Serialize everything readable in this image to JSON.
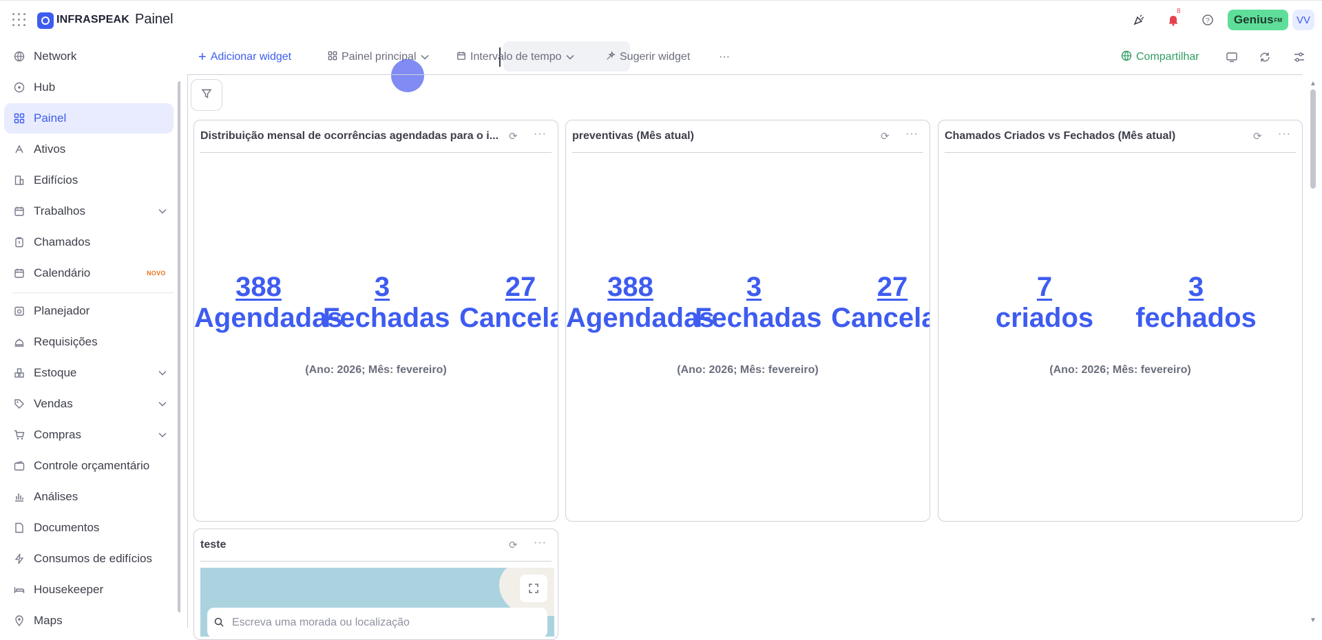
{
  "topbar": {
    "brand": "INFRASPEAK",
    "page_title": "Painel",
    "notification_count": "8",
    "genius_label": "Genius",
    "genius_suffix": "FM",
    "avatar_initials": "VV"
  },
  "sidebar": {
    "items": [
      {
        "label": "Network",
        "icon": "globe-icon"
      },
      {
        "label": "Hub",
        "icon": "hub-icon"
      },
      {
        "label": "Painel",
        "icon": "dashboard-icon",
        "active": true
      },
      {
        "label": "Ativos",
        "icon": "assets-icon"
      },
      {
        "label": "Edifícios",
        "icon": "building-icon"
      },
      {
        "label": "Trabalhos",
        "icon": "calendar-icon",
        "expandable": true
      },
      {
        "label": "Chamados",
        "icon": "clipboard-icon"
      },
      {
        "label": "Calendário",
        "icon": "calendar-icon",
        "badge": "NOVO"
      },
      {
        "label": "Planejador",
        "icon": "planner-icon"
      },
      {
        "label": "Requisições",
        "icon": "bell-service-icon"
      },
      {
        "label": "Estoque",
        "icon": "stock-icon",
        "expandable": true
      },
      {
        "label": "Vendas",
        "icon": "tag-icon",
        "expandable": true
      },
      {
        "label": "Compras",
        "icon": "cart-icon",
        "expandable": true
      },
      {
        "label": "Controle orçamentário",
        "icon": "wallet-icon"
      },
      {
        "label": "Análises",
        "icon": "bar-chart-icon"
      },
      {
        "label": "Documentos",
        "icon": "document-icon"
      },
      {
        "label": "Consumos de edifícios",
        "icon": "lightning-icon"
      },
      {
        "label": "Housekeeper",
        "icon": "bed-icon"
      },
      {
        "label": "Maps",
        "icon": "map-pin-icon"
      }
    ]
  },
  "toolbar": {
    "add_widget": "Adicionar widget",
    "dashboard_select": "Painel principal",
    "time_range": "Intervalo de tempo",
    "suggest_widget": "Sugerir widget",
    "more": "···",
    "share": "Compartilhar"
  },
  "widgets": [
    {
      "title": "Distribuição mensal de ocorrências agendadas para o i...",
      "stats": [
        {
          "value": "388",
          "label": "Agendadas"
        },
        {
          "value": "3",
          "label": "Fechadas"
        },
        {
          "value": "27",
          "label": "Cancelad"
        }
      ],
      "footnote": "(Ano: 2026; Mês: fevereiro)"
    },
    {
      "title": "preventivas (Mês atual)",
      "stats": [
        {
          "value": "388",
          "label": "Agendadas"
        },
        {
          "value": "3",
          "label": "Fechadas"
        },
        {
          "value": "27",
          "label": "Cancelad"
        }
      ],
      "footnote": "(Ano: 2026; Mês: fevereiro)"
    },
    {
      "title": "Chamados Criados vs Fechados (Mês atual)",
      "stats": [
        {
          "value": "7",
          "label": "criados"
        },
        {
          "value": "3",
          "label": "fechados"
        }
      ],
      "footnote": "(Ano: 2026; Mês: fevereiro)"
    },
    {
      "title": "teste",
      "map_search_placeholder": "Escreva uma morada ou localização"
    }
  ],
  "colors": {
    "accent": "#3e5cf0",
    "share_green": "#2f9e63",
    "genius_green": "#5fde9a",
    "active_bg": "#e8ecfe"
  }
}
